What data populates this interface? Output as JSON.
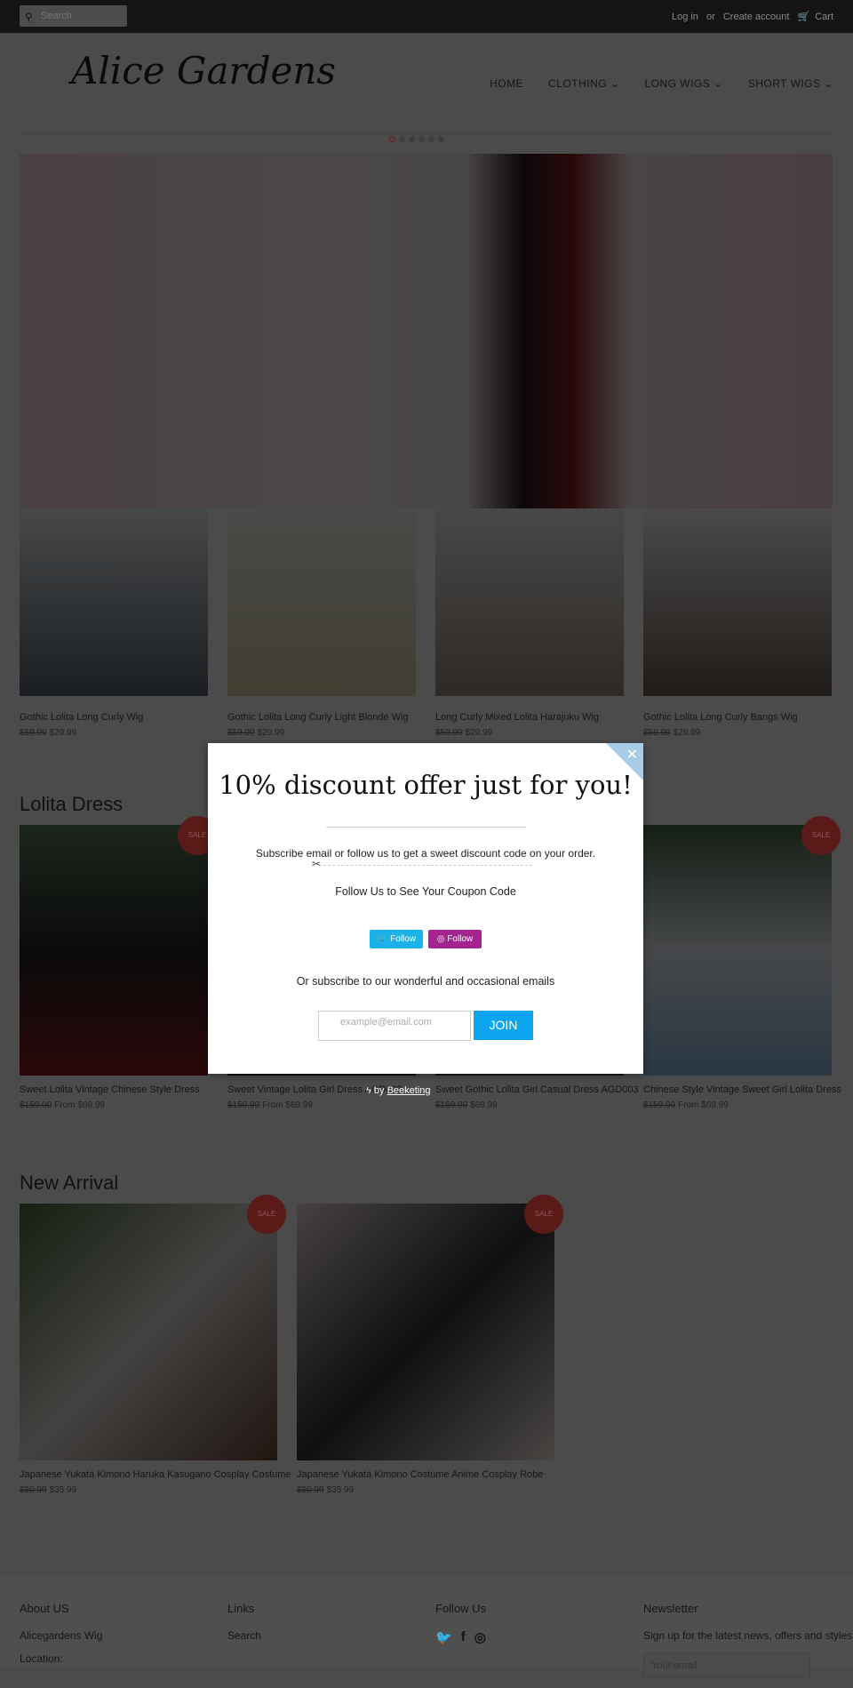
{
  "header": {
    "search_placeholder": "Search",
    "login": "Log in",
    "or": "or",
    "create_account": "Create account",
    "cart": "Cart",
    "logo": "Alice Gardens",
    "nav": [
      "HOME",
      "CLOTHING ⌄",
      "LONG WIGS ⌄",
      "SHORT WIGS ⌄"
    ]
  },
  "wigs": [
    {
      "title": "Gothic Lolita Long Curly Wig",
      "old": "$59.99",
      "price": "$29.99"
    },
    {
      "title": "Gothic Lolita Long Curly Light Blonde Wig",
      "old": "$59.99",
      "price": "$29.99"
    },
    {
      "title": "Long Curly Mixed Lolita Harajuku Wig",
      "old": "$59.99",
      "price": "$29.99"
    },
    {
      "title": "Gothic Lolita Long Curly Bangs Wig",
      "old": "$59.99",
      "price": "$29.99"
    }
  ],
  "lolita": {
    "heading": "Lolita Dress",
    "sale": "SALE",
    "items": [
      {
        "title": "Sweet Lolita Vintage Chinese Style Dress",
        "old": "$159.00",
        "price": "From $69.99"
      },
      {
        "title": "Sweet Vintage Lolita Girl Dress AGD002",
        "old": "$159.99",
        "price": "From $69.99"
      },
      {
        "title": "Sweet Gothic Lolita Girl Casual Dress AGD003",
        "old": "$159.99",
        "price": "$69.99"
      },
      {
        "title": "Chinese Style Vintage Sweet Girl Lolita Dress",
        "old": "$159.99",
        "price": "From $69.99"
      }
    ]
  },
  "arrival": {
    "heading": "New Arrival",
    "items": [
      {
        "title": "Japanese Yukata Kimono Haruka Kasugano Cosplay Costume",
        "old": "$80.99",
        "price": "$35.99"
      },
      {
        "title": "Japanese Yukata Kimono Costume Anime Cosplay Robe",
        "old": "$80.99",
        "price": "$35.99"
      }
    ]
  },
  "footer": {
    "about": "About US",
    "about_item": "Alicegardens Wig",
    "location": "Location:",
    "links": "Links",
    "search": "Search",
    "follow": "Follow Us",
    "newsletter": "Newsletter",
    "newsletter_text": "Sign up for the latest news, offers and styles",
    "email_placeholder": "Your email"
  },
  "popup": {
    "title": "10% discount offer just for you!",
    "subtitle": "Subscribe email or follow us to get a sweet discount code on your order.",
    "follow_text": "Follow Us to See Your Coupon Code",
    "twitter": "Follow",
    "instagram": "Follow",
    "or_text": "Or subscribe to our wonderful and occasional emails",
    "email_placeholder": "example@email.com",
    "join": "JOIN",
    "by": "by",
    "brand": "Beeketing",
    "twitter_color": "#1ab2e8",
    "instagram_color": "#a3248f"
  }
}
